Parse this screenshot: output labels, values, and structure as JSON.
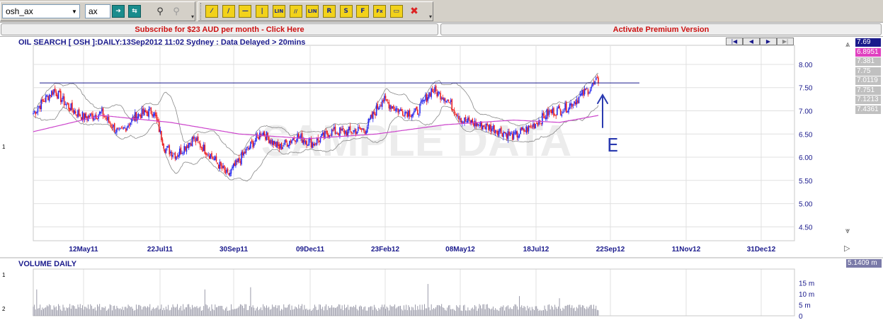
{
  "toolbar": {
    "symbol_value": "osh_ax",
    "exchange_value": "ax",
    "line_tools": [
      {
        "name": "draw-line-tool",
        "glyph": "⁄"
      },
      {
        "name": "diagonal-line-tool",
        "glyph": "/"
      },
      {
        "name": "horizontal-line-tool",
        "glyph": "—"
      },
      {
        "name": "vertical-line-tool",
        "glyph": "|"
      },
      {
        "name": "linear-regression-tool",
        "glyph": "LIN"
      },
      {
        "name": "parallel-line-tool",
        "glyph": "//"
      },
      {
        "name": "linear-regression-channel-tool",
        "glyph": "LIN"
      },
      {
        "name": "retracement-tool",
        "glyph": "R"
      },
      {
        "name": "speed-resistance-tool",
        "glyph": "S"
      },
      {
        "name": "fibonacci-fan-tool",
        "glyph": "F"
      },
      {
        "name": "fibonacci-extension-tool",
        "glyph": "Fx"
      },
      {
        "name": "text-note-tool",
        "glyph": "▭"
      }
    ],
    "icons": {
      "go": "arrow-right-icon",
      "refresh": "refresh-icon",
      "find": "binoculars-icon",
      "find2": "binoculars-gray-icon",
      "delete": "delete-x-icon"
    }
  },
  "banners": {
    "subscribe": "Subscribe for $23 AUD per month - Click Here",
    "premium": "Activate Premium Version"
  },
  "chart_title": "OIL SEARCH [ OSH ]:DAILY:13Sep2012 11:02 Sydney : Data Delayed > 20mins",
  "volume_title": "VOLUME DAILY",
  "nav_buttons": [
    "|◀",
    "◀",
    "▶",
    "▶|"
  ],
  "side_markers": {
    "price_pane": "1",
    "vol_top": "1",
    "vol_bottom": "2"
  },
  "price_tags": [
    {
      "label": "7.69",
      "color": "#1a1a8c"
    },
    {
      "label": "6.8951",
      "color": "#e040c0"
    },
    {
      "label": "7.381",
      "color": "#c0c0c0"
    },
    {
      "label": "7.75",
      "color": "#c0c0c0"
    },
    {
      "label": "7.0119",
      "color": "#c0c0c0"
    },
    {
      "label": "7.751",
      "color": "#c0c0c0"
    },
    {
      "label": "7.1213",
      "color": "#c0c0c0"
    },
    {
      "label": "7.4361",
      "color": "#c0c0c0"
    }
  ],
  "volume_tag": "5.1409 m",
  "annotation": {
    "letter": "E"
  },
  "colors": {
    "up": "#2a2aee",
    "down": "#ee2222",
    "ma": "#cc44cc",
    "band": "#888888",
    "axis_text": "#1a1a8c",
    "resistance": "#1a1a8c"
  },
  "chart_data": [
    {
      "type": "candlestick",
      "title": "OIL SEARCH [ OSH ]:DAILY:13Sep2012 11:02 Sydney : Data Delayed > 20mins",
      "x_ticks": [
        "12May11",
        "22Jul11",
        "30Sep11",
        "09Dec11",
        "23Feb12",
        "08May12",
        "18Jul12",
        "22Sep12",
        "11Nov12",
        "31Dec12"
      ],
      "y_ticks": [
        "8.00",
        "7.50",
        "7.00",
        "6.50",
        "6.00",
        "5.50",
        "5.00",
        "4.50"
      ],
      "ylim": [
        4.2,
        8.35
      ],
      "grid": true,
      "watermark": "SAMPLE DATA",
      "resistance_level": 7.6,
      "close_anchors": [
        {
          "i": 0,
          "v": 6.95
        },
        {
          "i": 12,
          "v": 7.3
        },
        {
          "i": 18,
          "v": 7.45
        },
        {
          "i": 30,
          "v": 7.1
        },
        {
          "i": 45,
          "v": 6.85
        },
        {
          "i": 60,
          "v": 6.95
        },
        {
          "i": 75,
          "v": 6.5
        },
        {
          "i": 90,
          "v": 6.9
        },
        {
          "i": 105,
          "v": 7.0
        },
        {
          "i": 115,
          "v": 6.2
        },
        {
          "i": 125,
          "v": 6.05
        },
        {
          "i": 140,
          "v": 6.4
        },
        {
          "i": 155,
          "v": 6.05
        },
        {
          "i": 170,
          "v": 5.6
        },
        {
          "i": 185,
          "v": 6.1
        },
        {
          "i": 200,
          "v": 6.55
        },
        {
          "i": 215,
          "v": 6.2
        },
        {
          "i": 230,
          "v": 6.45
        },
        {
          "i": 245,
          "v": 6.3
        },
        {
          "i": 260,
          "v": 6.55
        },
        {
          "i": 275,
          "v": 6.55
        },
        {
          "i": 290,
          "v": 6.6
        },
        {
          "i": 305,
          "v": 7.25
        },
        {
          "i": 320,
          "v": 7.0
        },
        {
          "i": 335,
          "v": 6.95
        },
        {
          "i": 348,
          "v": 7.45
        },
        {
          "i": 360,
          "v": 7.3
        },
        {
          "i": 375,
          "v": 6.8
        },
        {
          "i": 390,
          "v": 6.7
        },
        {
          "i": 405,
          "v": 6.6
        },
        {
          "i": 420,
          "v": 6.45
        },
        {
          "i": 435,
          "v": 6.65
        },
        {
          "i": 450,
          "v": 6.95
        },
        {
          "i": 465,
          "v": 7.05
        },
        {
          "i": 480,
          "v": 7.35
        },
        {
          "i": 494,
          "v": 7.65
        }
      ],
      "moving_average": [
        {
          "i": 0,
          "v": 6.55
        },
        {
          "i": 60,
          "v": 6.9
        },
        {
          "i": 120,
          "v": 6.75
        },
        {
          "i": 180,
          "v": 6.5
        },
        {
          "i": 240,
          "v": 6.4
        },
        {
          "i": 300,
          "v": 6.5
        },
        {
          "i": 360,
          "v": 6.7
        },
        {
          "i": 420,
          "v": 6.8
        },
        {
          "i": 460,
          "v": 6.75
        },
        {
          "i": 494,
          "v": 6.9
        }
      ],
      "bar_count": 495
    },
    {
      "type": "bar",
      "title": "VOLUME DAILY",
      "y_ticks": [
        "15 m",
        "10 m",
        "5 m",
        "0"
      ],
      "ylim": [
        0,
        20
      ],
      "spikes": [
        {
          "i": 3,
          "v": 12
        },
        {
          "i": 150,
          "v": 12
        },
        {
          "i": 190,
          "v": 13
        },
        {
          "i": 345,
          "v": 14.5
        },
        {
          "i": 425,
          "v": 9
        },
        {
          "i": 460,
          "v": 8
        }
      ]
    }
  ]
}
